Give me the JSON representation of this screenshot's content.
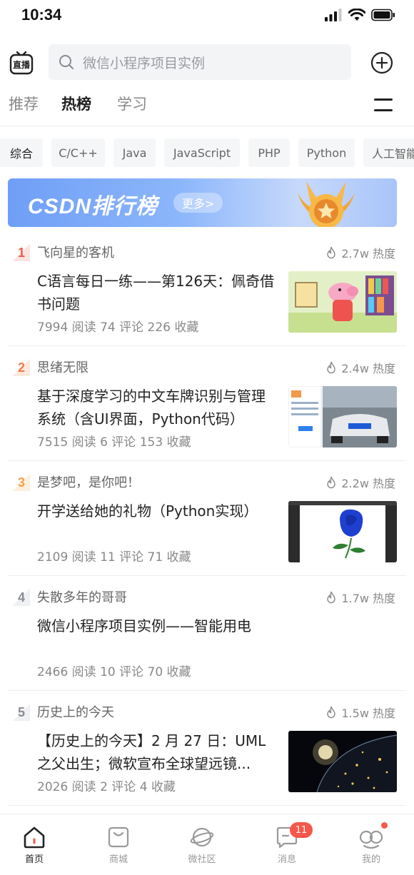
{
  "status_bar": {
    "time": "10:34"
  },
  "header": {
    "live_label": "直播",
    "search_placeholder": "微信小程序项目实例"
  },
  "tabs": [
    {
      "label": "推荐",
      "active": false
    },
    {
      "label": "热榜",
      "active": true
    },
    {
      "label": "学习",
      "active": false
    }
  ],
  "categories": [
    "综合",
    "C/C++",
    "Java",
    "JavaScript",
    "PHP",
    "Python",
    "人工智能"
  ],
  "banner": {
    "title": "CSDN排行榜",
    "more": "更多>"
  },
  "articles": [
    {
      "rank": "1",
      "author": "飞向星的客机",
      "heat": "2.7w 热度",
      "title": "C语言每日一练——第126天：佩奇借书问题",
      "stats": "7994 阅读  74 评论  226 收藏",
      "thumb": "peppa-illustration"
    },
    {
      "rank": "2",
      "author": "思绪无限",
      "heat": "2.4w 热度",
      "title": "基于深度学习的中文车牌识别与管理系统（含UI界面，Python代码）",
      "stats": "7515 阅读  6 评论  153 收藏",
      "thumb": "license-plate-app"
    },
    {
      "rank": "3",
      "author": "是梦吧，是你吧！",
      "heat": "2.2w 热度",
      "title": "开学送给她的礼物（Python实现）",
      "stats": "2109 阅读  11 评论  71 收藏",
      "thumb": "blue-rose-drawing"
    },
    {
      "rank": "4",
      "author": "失散多年的哥哥",
      "heat": "1.7w 热度",
      "title": "微信小程序项目实例——智能用电",
      "stats": "2466 阅读  10 评论  70 收藏",
      "thumb": ""
    },
    {
      "rank": "5",
      "author": "历史上的今天",
      "heat": "1.5w 热度",
      "title": "【历史上的今天】2 月 27 日：UML 之父出生；微软宣布全球望远镜...",
      "stats": "2026 阅读  2 评论  4 收藏",
      "thumb": "earth-at-night"
    }
  ],
  "bottom_nav": [
    {
      "label": "首页",
      "icon": "home-icon",
      "active": true
    },
    {
      "label": "商城",
      "icon": "shop-bag-icon",
      "active": false
    },
    {
      "label": "微社区",
      "icon": "planet-icon",
      "active": false
    },
    {
      "label": "消息",
      "icon": "message-icon",
      "active": false,
      "badge": "11"
    },
    {
      "label": "我的",
      "icon": "profile-icon",
      "active": false
    }
  ],
  "colors": {
    "accent": "#f5574a",
    "text": "#222222",
    "muted": "#888888",
    "banner": "#7aa7f8"
  }
}
